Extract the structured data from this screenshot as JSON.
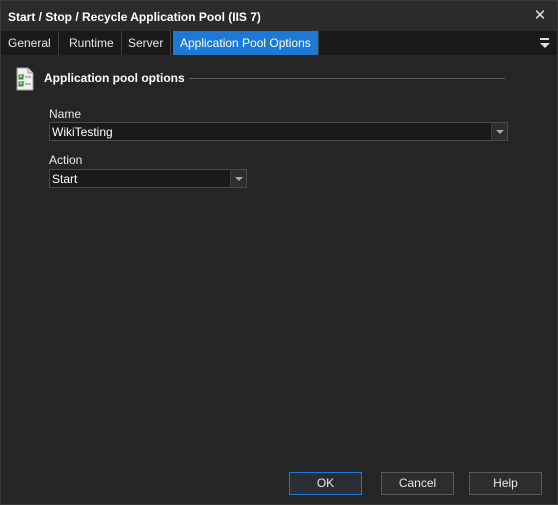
{
  "window": {
    "title": "Start / Stop / Recycle Application Pool (IIS 7)",
    "close_icon": "close-icon"
  },
  "tabs": [
    {
      "label": "General",
      "active": false
    },
    {
      "label": "Runtime",
      "active": false
    },
    {
      "label": "Server",
      "active": false
    },
    {
      "label": "Application Pool Options",
      "active": true
    }
  ],
  "section": {
    "icon": "checklist-document-icon",
    "title": "Application pool options"
  },
  "fields": {
    "name": {
      "label": "Name",
      "value": "WikiTesting"
    },
    "action": {
      "label": "Action",
      "value": "Start"
    }
  },
  "buttons": {
    "ok": "OK",
    "cancel": "Cancel",
    "help": "Help"
  },
  "colors": {
    "accent": "#1c7ad6",
    "background": "#252525",
    "tabbar": "#1a1a1a"
  }
}
